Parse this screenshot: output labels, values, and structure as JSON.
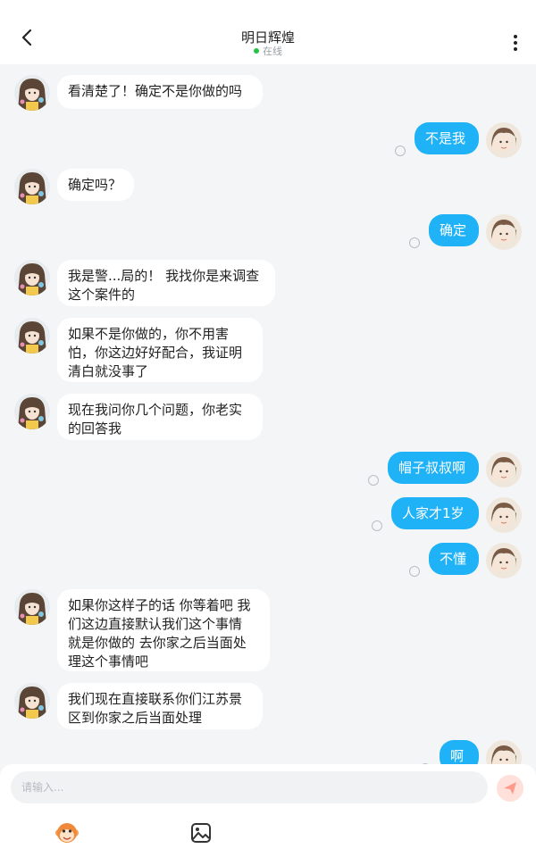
{
  "header": {
    "title": "明日辉煌",
    "status": "在线",
    "status_color": "#27c346",
    "back_icon": "chevron-left-icon",
    "more_icon": "more-vertical-icon"
  },
  "messages": [
    {
      "side": "left",
      "lines": [
        "看清楚了！确定不是你做的吗"
      ]
    },
    {
      "side": "right",
      "lines": [
        "不是我"
      ],
      "read": false
    },
    {
      "side": "left",
      "lines": [
        "确定吗？"
      ]
    },
    {
      "side": "right",
      "lines": [
        "确定"
      ],
      "read": false
    },
    {
      "side": "left",
      "lines": [
        "我是警...局的！ 我找你是来调查",
        "这个案件的"
      ]
    },
    {
      "side": "left",
      "lines": [
        "如果不是你做的，你不用害",
        "怕，你这边好好配合，我证明",
        "清白就没事了"
      ]
    },
    {
      "side": "left",
      "lines": [
        "现在我问你几个问题，你老实",
        "的回答我"
      ]
    },
    {
      "side": "right",
      "lines": [
        "帽子叔叔啊"
      ],
      "read": false
    },
    {
      "side": "right",
      "lines": [
        "人家才1岁"
      ],
      "read": false
    },
    {
      "side": "right",
      "lines": [
        "不懂"
      ],
      "read": false
    },
    {
      "side": "left",
      "lines": [
        "如果你这样子的话 你等着吧 我",
        "们这边直接默认我们这个事情",
        "就是你做的 去你家之后当面处",
        "理这个事情吧"
      ]
    },
    {
      "side": "left",
      "lines": [
        "我们现在直接联系你们江苏景",
        "区到你家之后当面处理"
      ]
    },
    {
      "side": "right",
      "lines": [
        "啊"
      ],
      "read": false
    }
  ],
  "composer": {
    "placeholder": "请输入...",
    "send_icon": "paper-plane-icon",
    "tools": [
      "monkey-emoji-icon",
      "image-icon"
    ]
  },
  "colors": {
    "accent": "#1fb2f6",
    "background": "#f4f5f7",
    "send_bg": "#ffe7e3"
  }
}
